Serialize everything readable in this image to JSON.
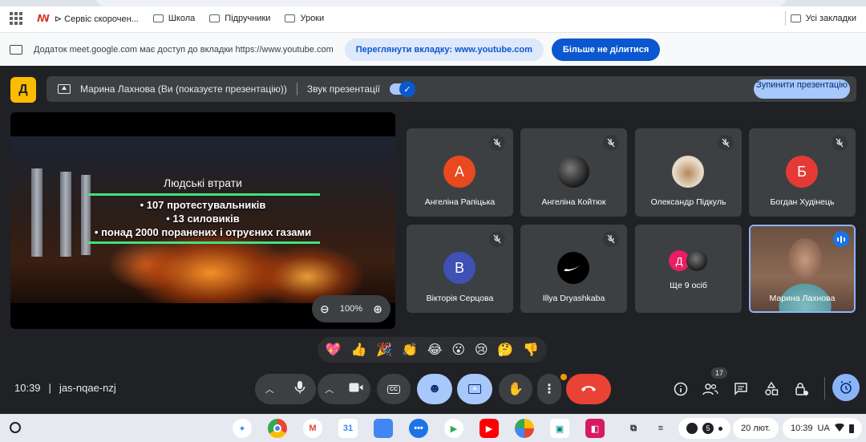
{
  "bookmarks": {
    "items": [
      "⊳ Сервіс скорочен...",
      "Школа",
      "Підручники",
      "Уроки"
    ],
    "all_label": "Усі закладки"
  },
  "share_bar": {
    "message": "Додаток meet.google.com має доступ до вкладки https://www.youtube.com",
    "view_tab_label": "Переглянути вкладку: www.youtube.com",
    "stop_sharing_label": "Більше не ділитися"
  },
  "meet_header": {
    "logo_glyph": "Д",
    "presenter_text": "Марина Лахнова (Ви (показуєте презентацію))",
    "sound_label": "Звук презентації",
    "sound_on": true,
    "stop_presentation_label": "Зупинити презентацію"
  },
  "slide": {
    "title": "Людські втрати",
    "lines": [
      "• 107 протестувальників",
      "• 13 силовиків",
      "• понад 2000 поранених і отруєних газами"
    ],
    "line_color": "#44e07a"
  },
  "zoom": {
    "level": "100%"
  },
  "participants": [
    {
      "name": "Ангеліна Рапіцька",
      "initial": "А",
      "color": "#e8491e",
      "muted": true
    },
    {
      "name": "Ангеліна Койтюк",
      "initial": "",
      "color": "#2a2a2a",
      "muted": true
    },
    {
      "name": "Олександр Підкуль",
      "initial": "",
      "color": "#d9c3a8",
      "muted": true
    },
    {
      "name": "Богдан Худінець",
      "initial": "Б",
      "color": "#e53935",
      "muted": true
    },
    {
      "name": "Вікторія Серцова",
      "initial": "В",
      "color": "#3f51b5",
      "muted": true
    },
    {
      "name": "Illya Dryashkaba",
      "initial": "",
      "color": "#000000",
      "muted": true
    },
    {
      "name": "Ще 9 осіб",
      "initial": "Д",
      "color": "#e91e63",
      "muted": false
    },
    {
      "name": "Марина Лахнова",
      "initial": "",
      "color": "",
      "muted": false,
      "self": true
    }
  ],
  "reactions": [
    "💖",
    "👍",
    "🎉",
    "👏",
    "😂",
    "😮",
    "😢",
    "🤔",
    "👎"
  ],
  "bottom_bar": {
    "time": "10:39",
    "separator": "|",
    "meeting_code": "jas-nqae-nzj",
    "people_count": "17"
  },
  "taskbar": {
    "date": "20 лют.",
    "time": "10:39",
    "locale": "UA",
    "notification_count": "5"
  },
  "colors": {
    "accent": "#8ab4f8",
    "end_call": "#ea4335",
    "background": "#202124",
    "tile": "#3c4043"
  }
}
